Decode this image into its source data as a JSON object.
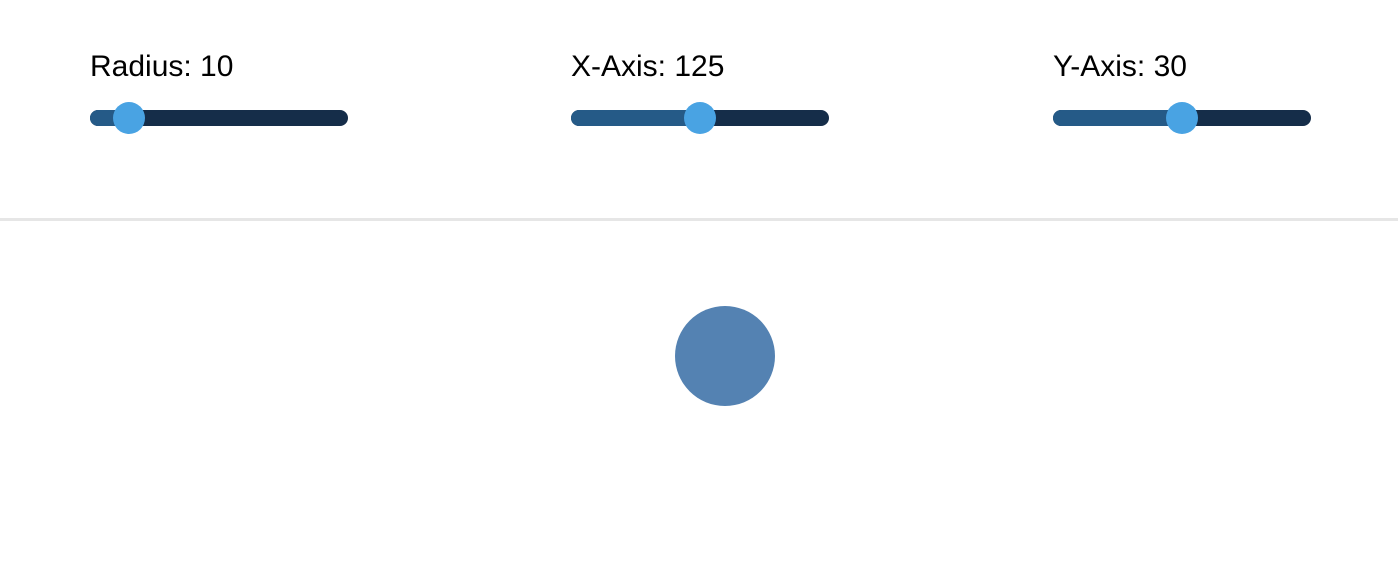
{
  "controls": {
    "radius": {
      "label": "Radius: 10",
      "value": 10,
      "min": 0,
      "max": 100
    },
    "x_axis": {
      "label": "X-Axis: 125",
      "value": 125,
      "min": 0,
      "max": 250
    },
    "y_axis": {
      "label": "Y-Axis: 30",
      "value": 30,
      "min": 0,
      "max": 60
    }
  },
  "colors": {
    "track": "#152d49",
    "fill": "#255a87",
    "thumb": "#49a3e3",
    "circle": "#5482b2",
    "divider": "#e6e6e6"
  }
}
